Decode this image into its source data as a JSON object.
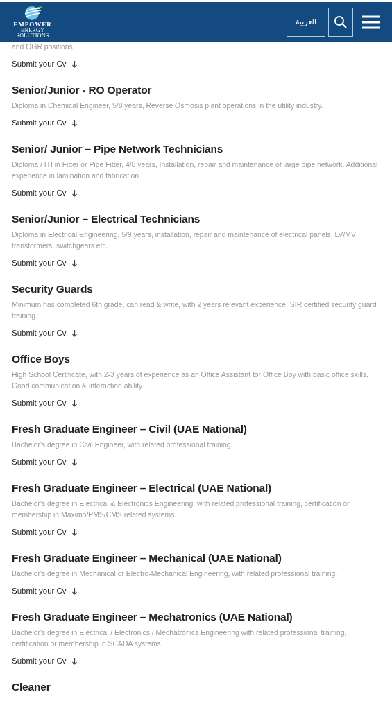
{
  "header": {
    "logo": {
      "name": "EMPOWER",
      "tagline_1": "ENERGY",
      "tagline_2": "SOLUTIONS"
    },
    "language_button": "العربية"
  },
  "jobs": [
    {
      "description": "and OGR positions.",
      "submit": "Submit your Cv"
    },
    {
      "title": "Senior/Junior - RO Operator",
      "description": "Diploma in Chemical Engineer, 5/8 years, Reverse Osmosis plant operations in the utility industry.",
      "submit": "Submit your Cv"
    },
    {
      "title": "Senior/ Junior – Pipe Network Technicians",
      "description": "Diploma / ITI in Fitter or Pipe Fitter, 4/8 years, Installation, repair and maintenance of large pipe network. Additional experience in lamination and fabrication",
      "submit": "Submit your Cv"
    },
    {
      "title": "Senior/Junior – Electrical Technicians",
      "description": "Diploma in Electrical Engineering, 5/9 years, installation, repair and maintenance of electrical panels, LV/MV transformers, switchgears etc.",
      "submit": "Submit your Cv"
    },
    {
      "title": "Security Guards",
      "description": "Minimum has completed 6th grade, can read & write, with 2 years relevant experience. SIR certified security guard training.",
      "submit": "Submit your Cv"
    },
    {
      "title": "Office Boys",
      "description": "High School Certificate, with 2-3 years of experience as an Office Assistant tor Office Boy with basic office skills. Good communication & interaction ability.",
      "submit": "Submit your Cv"
    },
    {
      "title": "Fresh Graduate Engineer – Civil (UAE National)",
      "description": "Bachelor's degree in Civil Engineer, with related professional training.",
      "submit": "Submit your Cv"
    },
    {
      "title": "Fresh Graduate Engineer – Electrical (UAE National)",
      "description": "Bachelor's degree in Electrical & Electronics Engineering, with related professional training, certification or membership in Maximo/PMS/CMS related systems.",
      "submit": "Submit your Cv"
    },
    {
      "title": "Fresh Graduate Engineer – Mechanical (UAE National)",
      "description": "Bachelor's degree in Mechanical or Electro-Mechanical Engineering, with related professional training.",
      "submit": "Submit your Cv"
    },
    {
      "title": "Fresh Graduate Engineer – Mechatronics (UAE National)",
      "description": "Bachelor's degree in Electrical / Electronics / Mechatronics Engineering with related professional training, certification or membership in SCADA systems",
      "submit": "Submit your Cv"
    },
    {
      "title": "Cleaner"
    }
  ]
}
